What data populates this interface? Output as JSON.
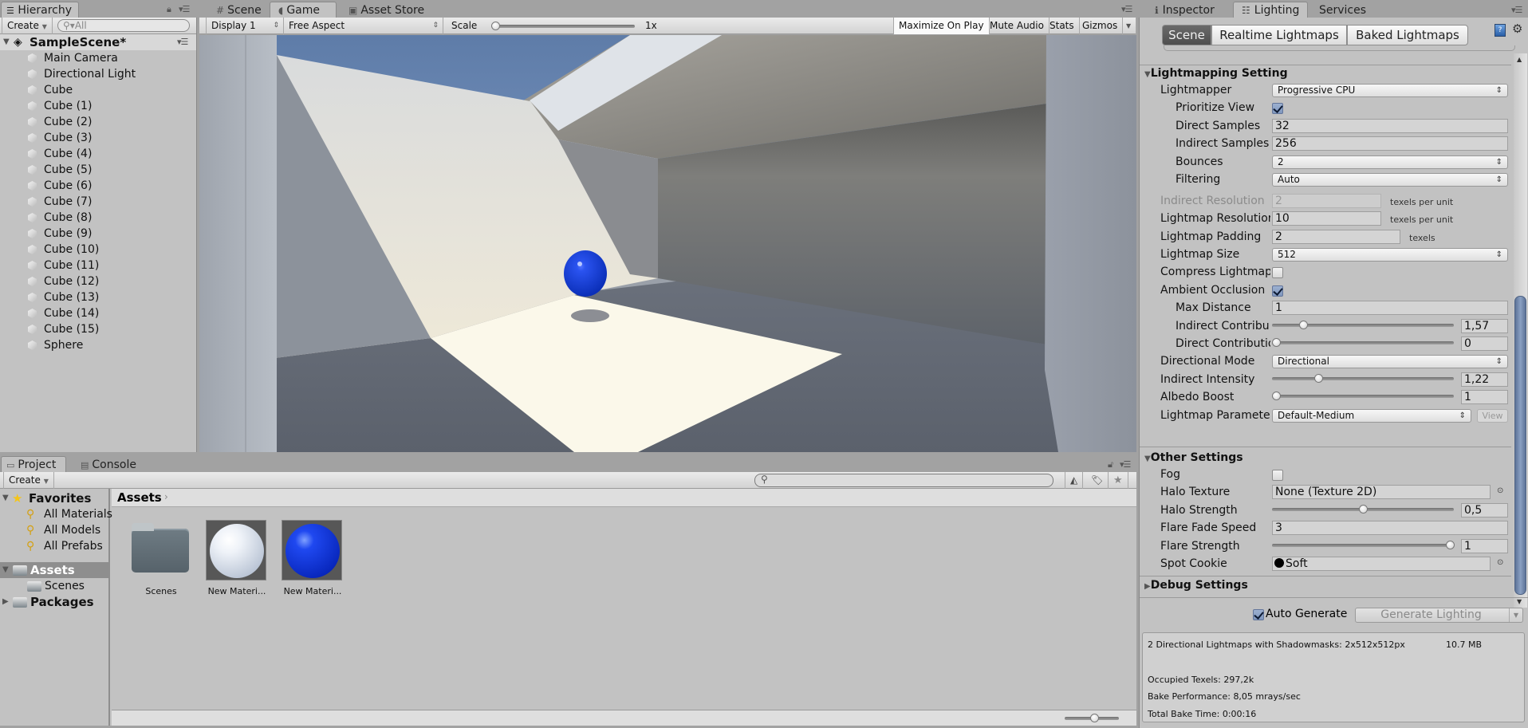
{
  "hierarchy": {
    "tab_label": "Hierarchy",
    "create_label": "Create",
    "search_placeholder": "All",
    "scene_name": "SampleScene*",
    "items": [
      "Main Camera",
      "Directional Light",
      "Cube",
      "Cube (1)",
      "Cube (2)",
      "Cube (3)",
      "Cube (4)",
      "Cube (5)",
      "Cube (6)",
      "Cube (7)",
      "Cube (8)",
      "Cube (9)",
      "Cube (10)",
      "Cube (11)",
      "Cube (12)",
      "Cube (13)",
      "Cube (14)",
      "Cube (15)",
      "Sphere"
    ]
  },
  "center": {
    "tabs": [
      {
        "label": "Scene",
        "icon": "grid-icon"
      },
      {
        "label": "Game",
        "icon": "pacman-icon",
        "active": true
      },
      {
        "label": "Asset Store",
        "icon": "store-icon"
      }
    ],
    "toolbar": {
      "display": "Display 1",
      "aspect": "Free Aspect",
      "scale_label": "Scale",
      "scale_value": "1x",
      "scale_fraction": 0.0,
      "maximize_on_play": "Maximize On Play",
      "mute_audio": "Mute Audio",
      "stats": "Stats",
      "gizmos": "Gizmos"
    },
    "colors": {
      "sky": "#6a88b4",
      "sphere": "#1a3fd6",
      "lit_floor": "#fbf8ea"
    }
  },
  "project": {
    "tabs": [
      {
        "label": "Project",
        "icon": "folder-icon",
        "active": true
      },
      {
        "label": "Console",
        "icon": "console-icon"
      }
    ],
    "create_label": "Create",
    "search_placeholder": "",
    "favorites": {
      "label": "Favorites",
      "items": [
        "All Materials",
        "All Models",
        "All Prefabs"
      ]
    },
    "tree": [
      {
        "label": "Assets",
        "expanded": true,
        "selected": true,
        "children": [
          "Scenes"
        ]
      },
      {
        "label": "Packages",
        "expanded": false
      }
    ],
    "breadcrumb": "Assets",
    "assets": [
      {
        "label": "Scenes",
        "type": "folder"
      },
      {
        "label": "New Materi...",
        "type": "material-white"
      },
      {
        "label": "New Materi...",
        "type": "material-blue"
      }
    ],
    "thumbnail_size_fraction": 0.55
  },
  "inspector": {
    "tabs": [
      {
        "label": "Inspector",
        "icon": "info-icon"
      },
      {
        "label": "Lighting",
        "icon": "lighting-icon",
        "active": true
      },
      {
        "label": "Services",
        "icon": ""
      }
    ],
    "subtabs": [
      {
        "label": "Scene",
        "active": true
      },
      {
        "label": "Realtime Lightmaps"
      },
      {
        "label": "Baked Lightmaps"
      }
    ],
    "lightmapping": {
      "title": "Lightmapping Setting",
      "lightmapper_label": "Lightmapper",
      "lightmapper": "Progressive CPU",
      "prioritize_label": "Prioritize View",
      "prioritize": true,
      "direct_samples_label": "Direct Samples",
      "direct_samples": "32",
      "indirect_samples_label": "Indirect Samples",
      "indirect_samples": "256",
      "bounces_label": "Bounces",
      "bounces": "2",
      "filtering_label": "Filtering",
      "filtering": "Auto",
      "indirect_res_label": "Indirect Resolution",
      "indirect_res": "2",
      "indirect_res_unit": "texels per unit",
      "lightmap_res_label": "Lightmap Resolutior",
      "lightmap_res": "10",
      "lightmap_res_unit": "texels per unit",
      "padding_label": "Lightmap Padding",
      "padding": "2",
      "padding_unit": "texels",
      "size_label": "Lightmap Size",
      "size": "512",
      "compress_label": "Compress Lightmap",
      "compress": false,
      "ao_label": "Ambient Occlusion",
      "ao": true,
      "max_distance_label": "Max Distance",
      "max_distance": "1",
      "indirect_contrib_label": "Indirect Contribu",
      "indirect_contrib": "1,57",
      "indirect_contrib_fraction": 0.157,
      "direct_contrib_label": "Direct Contributio",
      "direct_contrib": "0",
      "direct_contrib_fraction": 0.0,
      "directional_mode_label": "Directional Mode",
      "directional_mode": "Directional",
      "indirect_intensity_label": "Indirect Intensity",
      "indirect_intensity": "1,22",
      "indirect_intensity_fraction": 0.244,
      "albedo_label": "Albedo Boost",
      "albedo": "1",
      "albedo_fraction": 0.0,
      "params_label": "Lightmap Parameter",
      "params": "Default-Medium",
      "view_label": "View"
    },
    "other": {
      "title": "Other Settings",
      "fog_label": "Fog",
      "fog": false,
      "halo_texture_label": "Halo Texture",
      "halo_texture": "None (Texture 2D)",
      "halo_strength_label": "Halo Strength",
      "halo_strength": "0,5",
      "halo_strength_fraction": 0.5,
      "flare_fade_label": "Flare Fade Speed",
      "flare_fade": "3",
      "flare_strength_label": "Flare Strength",
      "flare_strength": "1",
      "flare_strength_fraction": 1.0,
      "spot_cookie_label": "Spot Cookie",
      "spot_cookie": "Soft"
    },
    "debug_title": "Debug Settings",
    "auto_generate_label": "Auto Generate",
    "auto_generate": true,
    "generate_label": "Generate Lighting",
    "stats": {
      "lightmaps": "2 Directional Lightmaps with Shadowmasks: 2x512x512px",
      "size": "10.7 MB",
      "occupied": "Occupied Texels: 297,2k",
      "performance": "Bake Performance: 8,05 mrays/sec",
      "bake_time": "Total Bake Time: 0:00:16"
    },
    "scroll_fraction": 0.5
  }
}
